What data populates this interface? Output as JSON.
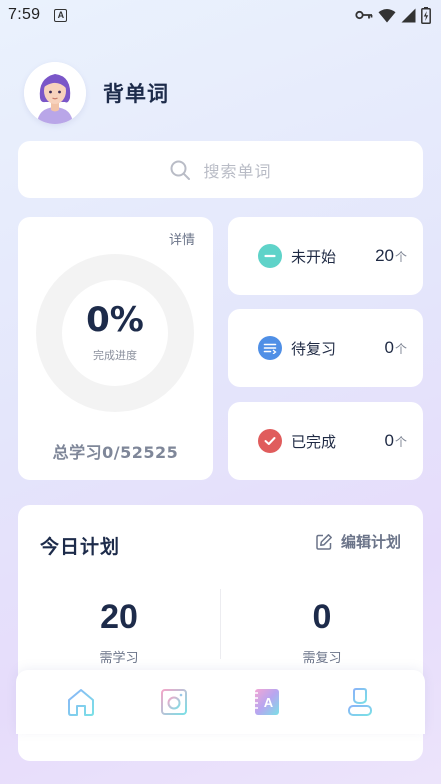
{
  "status_bar": {
    "time": "7:59",
    "a_glyph": "A"
  },
  "header": {
    "title": "背单词",
    "avatar": "avatar-illustration"
  },
  "search": {
    "placeholder": "搜索单词"
  },
  "progress": {
    "detail_label": "详情",
    "percent": "0%",
    "percent_value": 0,
    "caption": "完成进度",
    "total_label": "总学习0/52525"
  },
  "stats": [
    {
      "label": "未开始",
      "value": "20",
      "unit": "个",
      "icon": "minus-circle-icon",
      "color": "#5fd3c9"
    },
    {
      "label": "待复习",
      "value": "0",
      "unit": "个",
      "icon": "list-circle-icon",
      "color": "#4f8fe6"
    },
    {
      "label": "已完成",
      "value": "0",
      "unit": "个",
      "icon": "check-circle-icon",
      "color": "#e05c5c"
    }
  ],
  "plan": {
    "title": "今日计划",
    "edit_label": "编辑计划",
    "learn_count": "20",
    "learn_label": "需学习",
    "review_count": "0",
    "review_label": "需复习"
  },
  "nav": [
    {
      "name": "home",
      "icon": "home-icon"
    },
    {
      "name": "camera",
      "icon": "camera-icon"
    },
    {
      "name": "dictionary",
      "icon": "dictionary-icon",
      "glyph": "A"
    },
    {
      "name": "profile",
      "icon": "profile-icon"
    }
  ],
  "colors": {
    "accent_teal": "#7be0e6",
    "accent_blue": "#8ab4f8",
    "ring_track": "#f3f3f3"
  }
}
